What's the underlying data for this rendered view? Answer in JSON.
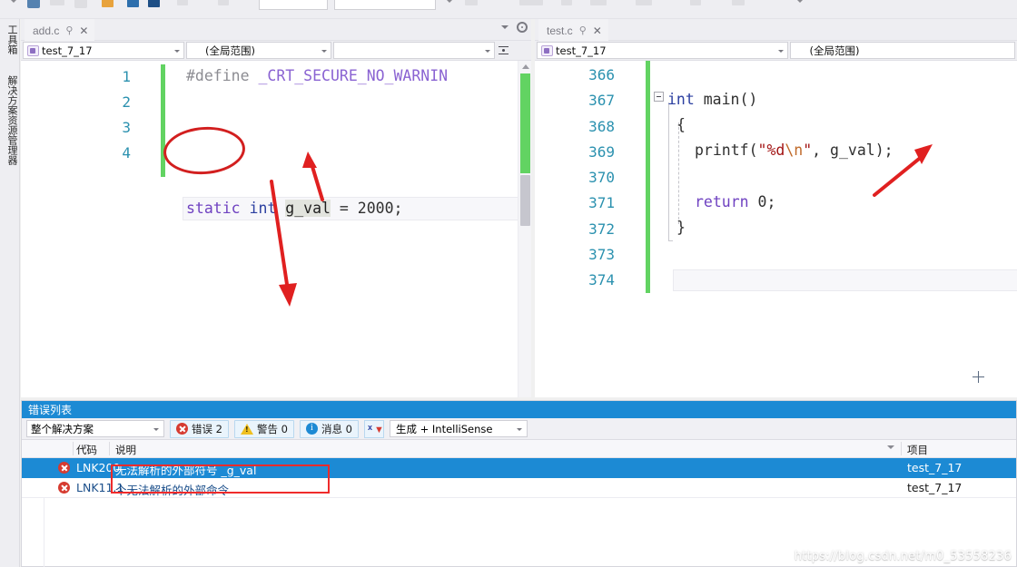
{
  "dock": {
    "toolbox_label": "工具箱",
    "solution_label": "解决方案资源管理器"
  },
  "editor_left": {
    "tab": {
      "title": "add.c",
      "pin_glyph": "⚲",
      "close_glyph": "✕"
    },
    "nav": {
      "project": "test_7_17",
      "scope": "(全局范围)",
      "member": ""
    },
    "lines": [
      {
        "num": "1",
        "text": "#define _CRT_SECURE_NO_WARNIN"
      },
      {
        "num": "2",
        "text": ""
      },
      {
        "num": "3",
        "text": ""
      },
      {
        "num": "4",
        "text": "static int g_val = 2000;"
      }
    ],
    "tokens_line1": {
      "directive": "#define",
      "macro": "_CRT_SECURE_NO_WARNIN"
    },
    "tokens_line4": {
      "kw_static": "static",
      "kw_int": "int",
      "ident": "g_val",
      "op": "=",
      "value": "2000",
      "semi": ";"
    }
  },
  "editor_right": {
    "tab": {
      "title": "test.c",
      "pin_glyph": "⚲",
      "close_glyph": "✕"
    },
    "nav": {
      "project": "test_7_17",
      "scope": "(全局范围)",
      "member": ""
    },
    "lines": [
      {
        "num": "366",
        "text": ""
      },
      {
        "num": "367",
        "text": "int main()"
      },
      {
        "num": "368",
        "text": "{"
      },
      {
        "num": "369",
        "text": "    printf(\"%d\\n\", g_val);"
      },
      {
        "num": "370",
        "text": ""
      },
      {
        "num": "371",
        "text": "    return 0;"
      },
      {
        "num": "372",
        "text": "}"
      },
      {
        "num": "373",
        "text": ""
      },
      {
        "num": "374",
        "text": ""
      }
    ],
    "tokens": {
      "kw_int": "int",
      "fn_main": "main()",
      "brace_open": "{",
      "fn_printf": "printf",
      "paren_open": "(",
      "str_quote": "\"",
      "str_pct_d": "%d",
      "str_escape": "\\n",
      "comma": ", ",
      "ident_gval": "g_val",
      "paren_close": ")",
      "semi": ";",
      "kw_return": "return",
      "zero": "0",
      "brace_close": "}"
    }
  },
  "error_list": {
    "title": "错误列表",
    "scope_filter": "整个解决方案",
    "counts": {
      "errors": "错误 2",
      "warnings": "警告 0",
      "messages": "消息 0"
    },
    "filter_button": "filter",
    "build_filter": "生成 + IntelliSense",
    "columns": {
      "code": "代码",
      "description": "说明",
      "project": "项目"
    },
    "rows": [
      {
        "severity": "error",
        "code": "LNK200",
        "description": "无法解析的外部符号 _g_val",
        "project": "test_7_17",
        "selected": true
      },
      {
        "severity": "error",
        "code": "LNK11.1",
        "description": "个无法解析的外部命令",
        "project": "test_7_17",
        "selected": false
      }
    ]
  },
  "watermark": {
    "text": "https://blog.csdn.net/m0_53558236"
  },
  "colors": {
    "accent_blue": "#1c8ad4",
    "error_red": "#d63b30",
    "warning_yellow": "#f0c020",
    "changebar_green": "#62d362",
    "annotation_red": "#d21f1f",
    "linenumber_teal": "#2b91af"
  }
}
